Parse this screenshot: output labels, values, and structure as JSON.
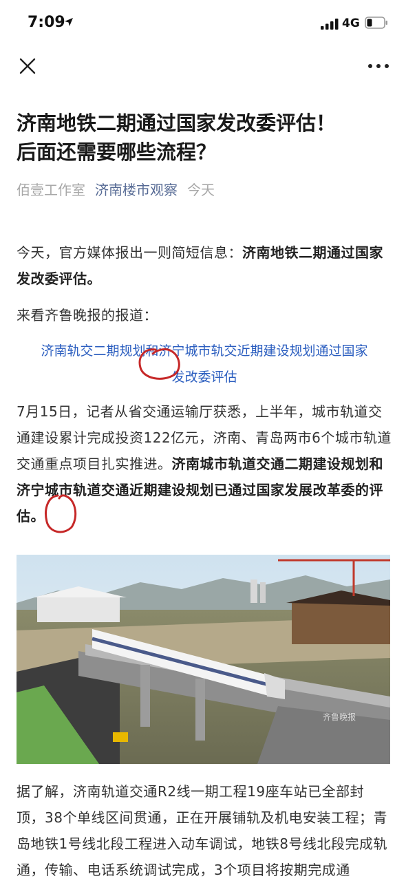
{
  "status_bar": {
    "time": "7:09",
    "network": "4G",
    "icons": [
      "location-arrow-icon",
      "signal-icon",
      "battery-icon"
    ]
  },
  "nav": {
    "icons": [
      "close-icon",
      "more-icon"
    ]
  },
  "article": {
    "title_line1": "济南地铁二期通过国家发改委评估！",
    "title_line2": "后面还需要哪些流程？",
    "author": "佰壹工作室",
    "account": "济南楼市观察",
    "date": "今天",
    "p1_text": "今天，官方媒体报出一则简短信息：",
    "p1_bold": "济南地铁二期通过国家发改委评估。",
    "p2": "来看齐鲁晚报的报道：",
    "quote_line1": "济南轨交二期规划和济宁城市轨交近期建设规划通过国家",
    "quote_line2": "发改委评估",
    "p3_text": "7月15日，记者从省交通运输厅获悉，上半年，城市轨道交通建设累计完成投资122亿元，济南、青岛两市6个城市轨道交通重点项目扎实推进。",
    "p3_bold": "济南城市轨道交通二期建设规划和济宁城市轨道交通近期建设规划已通过国家发展改革委的评估。",
    "photo_watermark": "齐鲁晚报",
    "p4": "据了解，济南轨道交通R2线一期工程19座车站已全部封顶，38个单线区间贯通，正在开展铺轨及机电安装工程；青岛地铁1号线北段工程进入动车调试，地铁8号线北段完成轨通，传输、电话系统调试完成，3个项目将按期完成通"
  },
  "colors": {
    "link_blue": "#576b95",
    "quote_blue": "#2a5dbf",
    "meta_gray": "#a8a8a8",
    "annotation_red": "#c62828"
  }
}
